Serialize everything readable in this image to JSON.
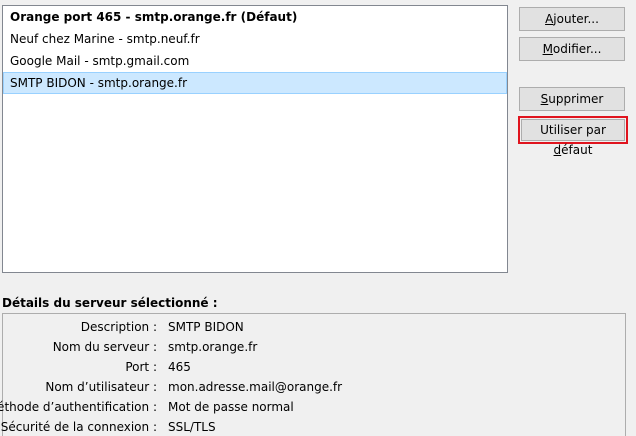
{
  "servers": [
    {
      "label": "Orange port 465 - smtp.orange.fr (Défaut)"
    },
    {
      "label": "Neuf chez Marine - smtp.neuf.fr"
    },
    {
      "label": "Google Mail - smtp.gmail.com"
    },
    {
      "label": "SMTP BIDON - smtp.orange.fr"
    }
  ],
  "selected_server": "SMTP BIDON - smtp.orange.fr",
  "buttons": {
    "add": {
      "accel": "A",
      "rest": "jouter..."
    },
    "edit": {
      "accel": "M",
      "rest": "odifier..."
    },
    "delete": {
      "accel": "S",
      "rest": "upprimer"
    },
    "set_default": {
      "before": "Utiliser par ",
      "accel": "d",
      "after": "éfaut"
    }
  },
  "details": {
    "title": "Détails du serveur sélectionné :",
    "rows": [
      {
        "label": "Description :",
        "value": "SMTP BIDON"
      },
      {
        "label": "Nom du serveur :",
        "value": "smtp.orange.fr"
      },
      {
        "label": "Port :",
        "value": "465"
      },
      {
        "label": "Nom d’utilisateur :",
        "value": "mon.adresse.mail@orange.fr"
      },
      {
        "label": "Méthode d’authentification :",
        "value": "Mot de passe normal"
      },
      {
        "label": "Sécurité de la connexion :",
        "value": "SSL/TLS"
      }
    ]
  },
  "colors": {
    "selection": "#cce8ff",
    "highlight_border": "#e0141e"
  }
}
